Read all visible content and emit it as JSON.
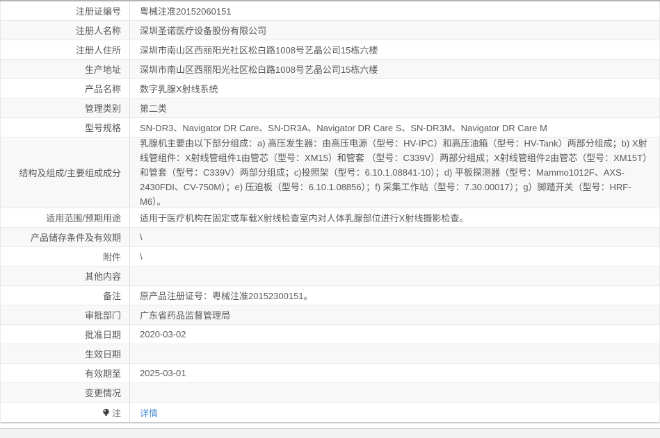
{
  "colors": {
    "link": "#4a90d5",
    "row_alt_bg": "#f8f8f8",
    "border": "#e9e9e9",
    "text": "#58595b"
  },
  "table": {
    "rows": [
      {
        "key": "registration-number",
        "label": "注册证编号",
        "value": "粤械注准20152060151"
      },
      {
        "key": "registrant-name",
        "label": "注册人名称",
        "value": "深圳圣诺医疗设备股份有限公司"
      },
      {
        "key": "registrant-address",
        "label": "注册人住所",
        "value": "深圳市南山区西丽阳光社区松白路1008号艺晶公司15栋六楼"
      },
      {
        "key": "production-address",
        "label": "生产地址",
        "value": "深圳市南山区西丽阳光社区松白路1008号艺晶公司15栋六楼"
      },
      {
        "key": "product-name",
        "label": "产品名称",
        "value": "数字乳腺X射线系统"
      },
      {
        "key": "management-class",
        "label": "管理类别",
        "value": "第二类"
      },
      {
        "key": "model-spec",
        "label": "型号规格",
        "value": "SN-DR3、Navigator DR Care、SN-DR3A、Navigator DR Care S、SN-DR3M、Navigator DR Care M"
      },
      {
        "key": "composition",
        "label": "结构及组成/主要组成成分",
        "value": "乳腺机主要由以下部分组成：a) 高压发生器：由高压电源（型号：HV-IPC）和高压油箱（型号：HV-Tank）两部分组成；b) X射线管组件：X射线管组件1由管芯（型号：XM15）和管套 （型号：C339V）两部分组成；X射线管组件2由管芯（型号：XM15T）和管套（型号：C339V）两部分组成；c)投照架（型号：6.10.1.08841-10）；d) 平板探测器（型号：Mammo1012F、AXS-2430FDI、CV-750M）；e) 压迫板（型号：6.10.1.08856）；f) 采集工作站（型号：7.30.00017）；g）脚踏开关（型号：HRF-M6）。",
        "tall": true
      },
      {
        "key": "intended-use",
        "label": "适用范围/预期用途",
        "value": "适用于医疗机构在固定或车载X射线检查室内对人体乳腺部位进行X射线摄影检查。"
      },
      {
        "key": "storage-conditions",
        "label": "产品储存条件及有效期",
        "value": "\\"
      },
      {
        "key": "attachments",
        "label": "附件",
        "value": "\\"
      },
      {
        "key": "other-content",
        "label": "其他内容",
        "value": ""
      },
      {
        "key": "remarks",
        "label": "备注",
        "value": "原产品注册证号：粤械注准20152300151。"
      },
      {
        "key": "approval-department",
        "label": "审批部门",
        "value": "广东省药品监督管理局"
      },
      {
        "key": "approval-date",
        "label": "批准日期",
        "value": "2020-03-02"
      },
      {
        "key": "effective-date",
        "label": "生效日期",
        "value": ""
      },
      {
        "key": "valid-until",
        "label": "有效期至",
        "value": "2025-03-01"
      },
      {
        "key": "change-status",
        "label": "变更情况",
        "value": ""
      },
      {
        "key": "note",
        "label": "注",
        "value": "详情",
        "link": true,
        "icon": "bulb-icon"
      }
    ]
  }
}
